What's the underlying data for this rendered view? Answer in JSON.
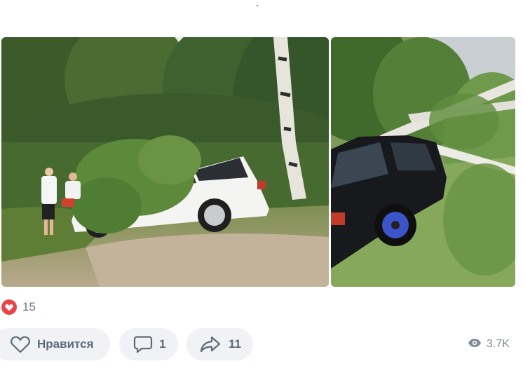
{
  "post": {
    "photos": [
      "car-under-fallen-birch-white",
      "car-under-fallen-birch-black"
    ],
    "likes_count": "15",
    "like_label": "Нравится",
    "comments_count": "1",
    "shares_count": "11",
    "views": "3.7K"
  },
  "icons": {
    "likes": "heart-icon",
    "like": "heart-outline-icon",
    "comment": "comment-icon",
    "share": "share-icon",
    "views": "eye-icon"
  },
  "colors": {
    "heart": "#e64646",
    "button_bg": "#f0f2f5",
    "button_text": "#5d6b7a",
    "muted": "#818c99"
  }
}
